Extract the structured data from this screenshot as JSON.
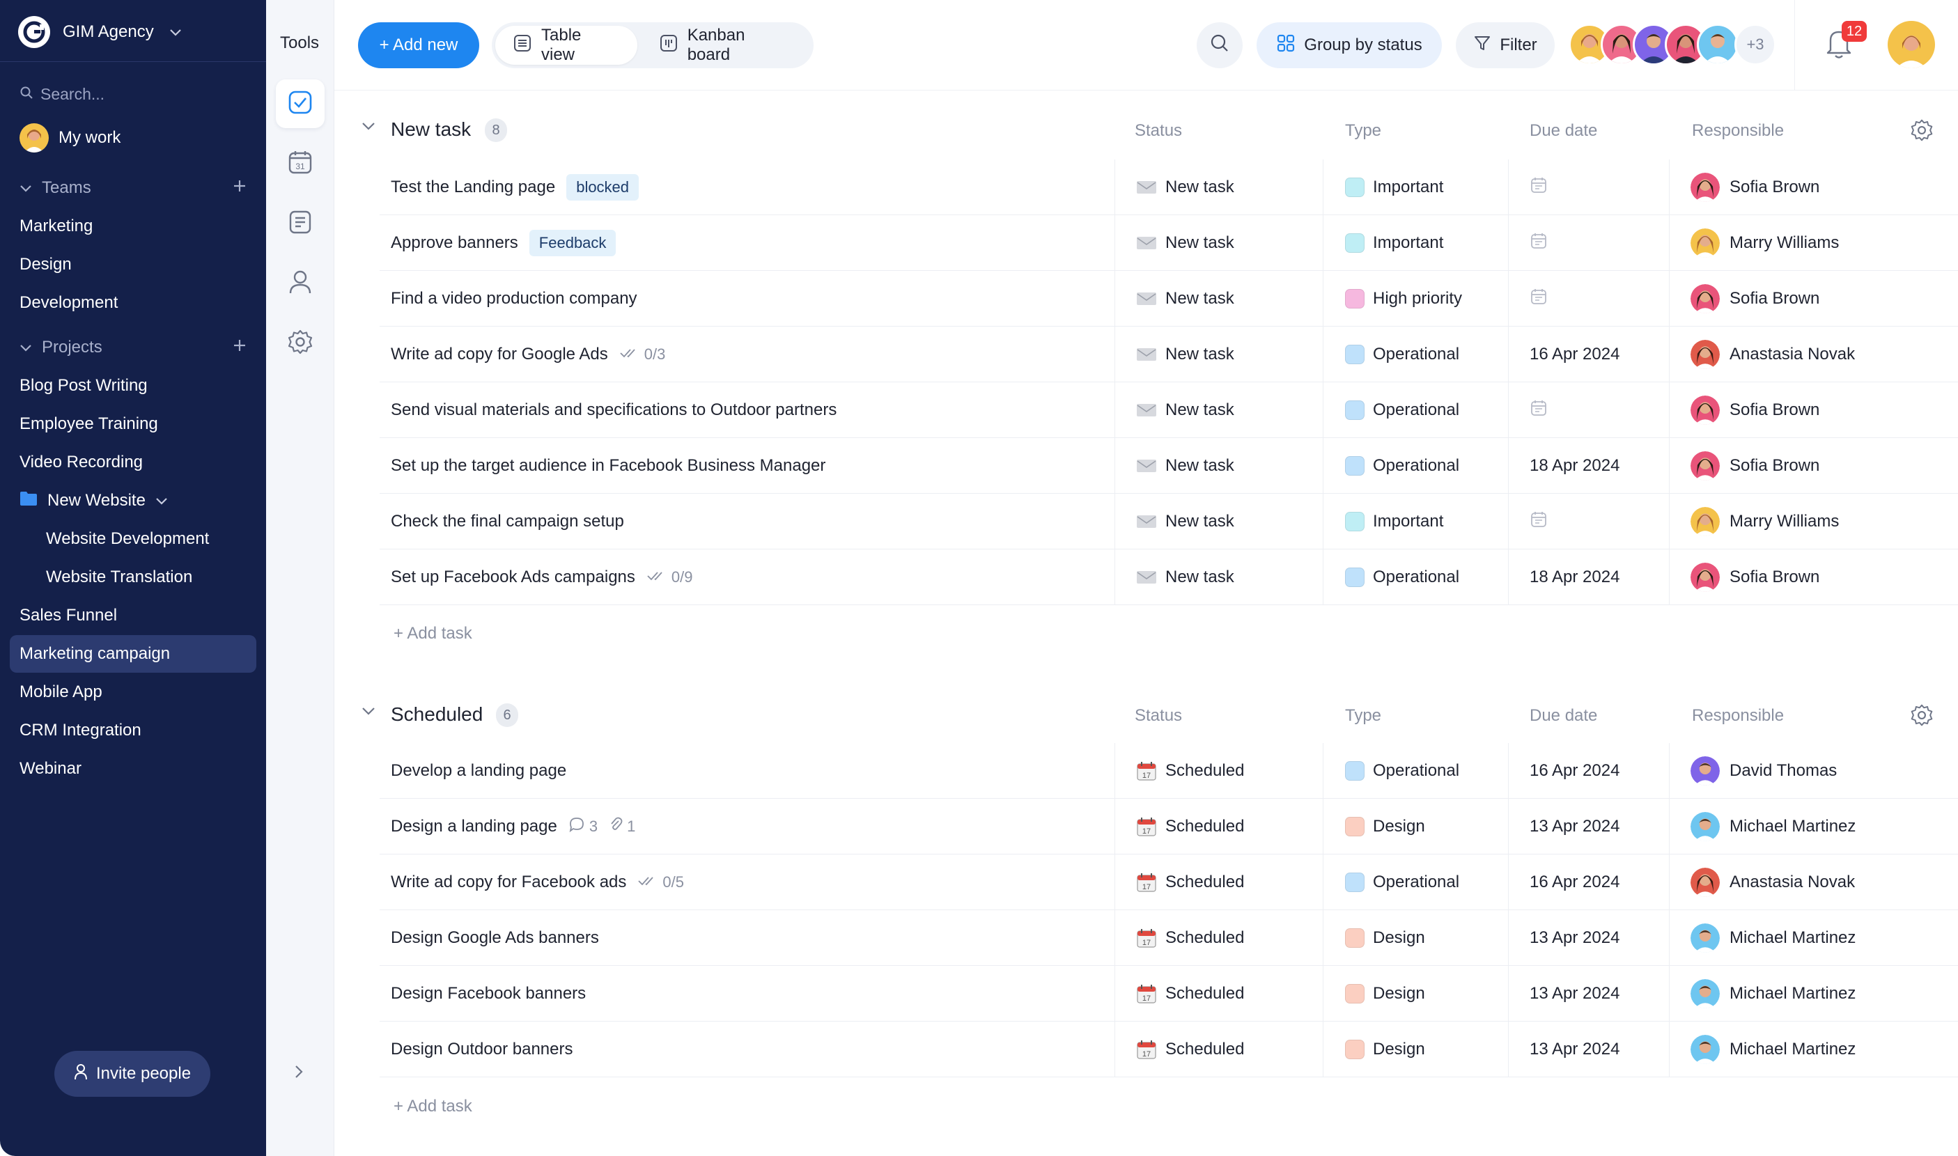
{
  "sidebar": {
    "org_name": "GIM Agency",
    "search_placeholder": "Search...",
    "my_work": "My work",
    "teams_label": "Teams",
    "teams": [
      "Marketing",
      "Design",
      "Development"
    ],
    "projects_label": "Projects",
    "projects": [
      {
        "label": "Blog Post Writing",
        "level": 0
      },
      {
        "label": "Employee Training",
        "level": 0
      },
      {
        "label": "Video Recording",
        "level": 0
      },
      {
        "label": "New Website",
        "level": 0,
        "folder": true
      },
      {
        "label": "Website Development",
        "level": 1
      },
      {
        "label": "Website Translation",
        "level": 1
      },
      {
        "label": "Sales Funnel",
        "level": 0
      },
      {
        "label": "Marketing campaign",
        "level": 0,
        "active": true
      },
      {
        "label": "Mobile App",
        "level": 0
      },
      {
        "label": "CRM Integration",
        "level": 0
      },
      {
        "label": "Webinar",
        "level": 0
      }
    ],
    "invite_label": "Invite people"
  },
  "tools": {
    "title": "Tools",
    "items": [
      "tasks-icon",
      "calendar-icon",
      "notes-icon",
      "person-icon",
      "settings-icon"
    ],
    "calendar_day": "31"
  },
  "toolbar": {
    "add_new": "+ Add new",
    "table_view": "Table view",
    "kanban_board": "Kanban board",
    "group_by": "Group by status",
    "filter": "Filter",
    "more_members": "+3",
    "notifications": "12"
  },
  "columns": {
    "status": "Status",
    "type": "Type",
    "due_date": "Due date",
    "responsible": "Responsible"
  },
  "colors": {
    "accent": "#1e86f0",
    "sidebar": "#14204a",
    "important": "#bfeef5",
    "high_priority": "#f6b8df",
    "operational": "#bfe1fb",
    "design": "#fbcfc1"
  },
  "groups": [
    {
      "name": "New task",
      "count": "8",
      "add_task": "+ Add task",
      "rows": [
        {
          "title": "Test the Landing page",
          "tag": "blocked",
          "status": "New task",
          "type": "Important",
          "due": "",
          "responsible": "Sofia Brown"
        },
        {
          "title": "Approve banners",
          "tag": "Feedback",
          "status": "New task",
          "type": "Important",
          "due": "",
          "responsible": "Marry Williams"
        },
        {
          "title": "Find a video production company",
          "status": "New task",
          "type": "High priority",
          "due": "",
          "responsible": "Sofia Brown"
        },
        {
          "title": "Write ad copy for Google Ads",
          "checklist": "0/3",
          "status": "New task",
          "type": "Operational",
          "due": "16 Apr 2024",
          "responsible": "Anastasia Novak"
        },
        {
          "title": "Send visual materials and specifications to Outdoor partners",
          "status": "New task",
          "type": "Operational",
          "due": "",
          "responsible": "Sofia Brown"
        },
        {
          "title": "Set up the target audience in Facebook Business Manager",
          "status": "New task",
          "type": "Operational",
          "due": "18 Apr 2024",
          "responsible": "Sofia Brown"
        },
        {
          "title": "Check the final campaign setup",
          "status": "New task",
          "type": "Important",
          "due": "",
          "responsible": "Marry Williams"
        },
        {
          "title": "Set up Facebook Ads campaigns",
          "checklist": "0/9",
          "status": "New task",
          "type": "Operational",
          "due": "18 Apr 2024",
          "responsible": "Sofia Brown"
        }
      ]
    },
    {
      "name": "Scheduled",
      "count": "6",
      "add_task": "+ Add task",
      "rows": [
        {
          "title": "Develop a landing page",
          "status": "Scheduled",
          "type": "Operational",
          "due": "16 Apr 2024",
          "responsible": "David Thomas"
        },
        {
          "title": "Design a landing page",
          "comments": "3",
          "attachments": "1",
          "status": "Scheduled",
          "type": "Design",
          "due": "13 Apr 2024",
          "responsible": "Michael Martinez"
        },
        {
          "title": "Write ad copy for Facebook ads",
          "checklist": "0/5",
          "status": "Scheduled",
          "type": "Operational",
          "due": "16 Apr 2024",
          "responsible": "Anastasia Novak"
        },
        {
          "title": "Design Google Ads banners",
          "status": "Scheduled",
          "type": "Design",
          "due": "13 Apr 2024",
          "responsible": "Michael Martinez"
        },
        {
          "title": "Design Facebook banners",
          "status": "Scheduled",
          "type": "Design",
          "due": "13 Apr 2024",
          "responsible": "Michael Martinez"
        },
        {
          "title": "Design Outdoor banners",
          "status": "Scheduled",
          "type": "Design",
          "due": "13 Apr 2024",
          "responsible": "Michael Martinez"
        }
      ]
    }
  ]
}
